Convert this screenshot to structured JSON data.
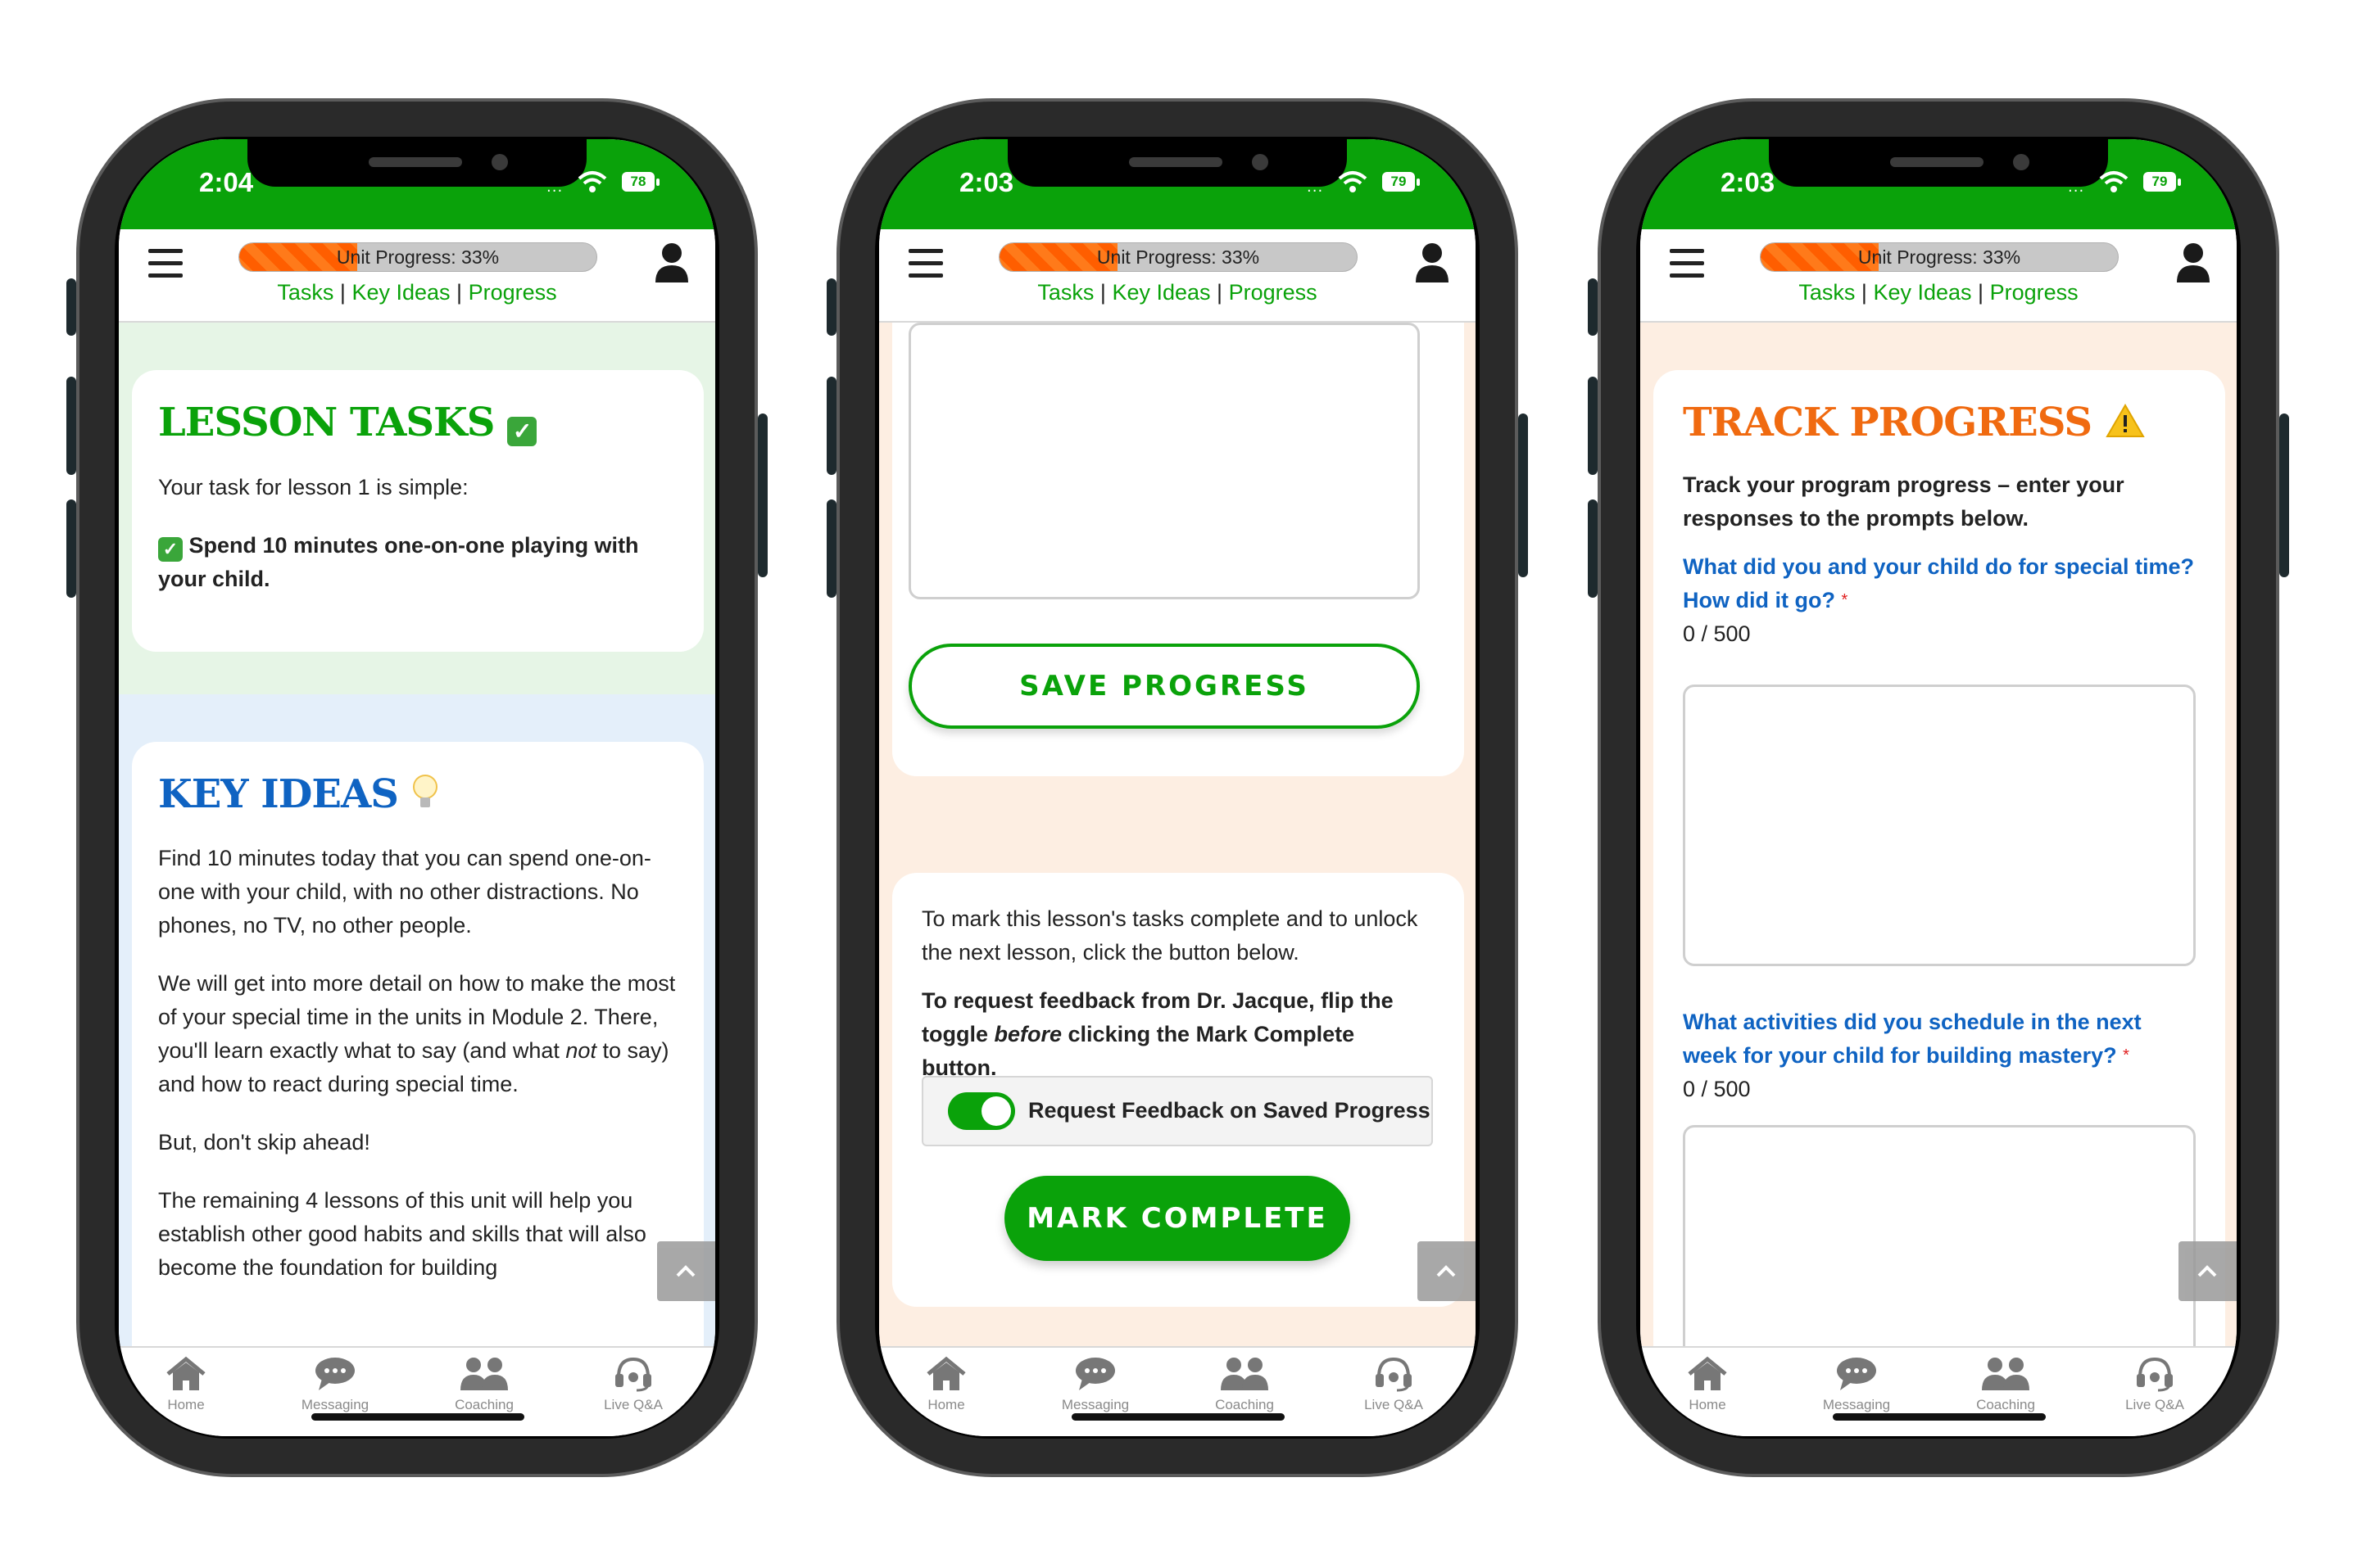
{
  "common": {
    "progress_label": "Unit Progress: 33%",
    "progress_fraction": 0.33,
    "nav": {
      "tasks": "Tasks",
      "key_ideas": "Key Ideas",
      "progress": "Progress",
      "separator": "|"
    },
    "tabs": [
      {
        "label": "Home",
        "icon": "home-icon"
      },
      {
        "label": "Messaging",
        "icon": "chat-bubble-icon"
      },
      {
        "label": "Coaching",
        "icon": "people-icon"
      },
      {
        "label": "Live Q&A",
        "icon": "headset-icon"
      }
    ],
    "signal": "..."
  },
  "phone1": {
    "time": "2:04",
    "battery": "78",
    "lesson_tasks": {
      "title": "LESSON TASKS",
      "intro": "Your task for lesson 1 is simple:",
      "task": "Spend 10 minutes one-on-one playing with your child."
    },
    "key_ideas": {
      "title": "KEY IDEAS",
      "p1": "Find 10 minutes today that you can spend one-on-one with your child, with no other distractions. No phones, no TV, no other people.",
      "p2_a": "We will get into more detail on how to make the most of your special time in the units in Module 2.  There, you'll learn exactly what to say (and what ",
      "p2_em": "not",
      "p2_b": " to say) and how to react during special time.",
      "p3": "But, don't skip ahead!",
      "p4": "The remaining 4 lessons of this unit will help you establish other good habits and skills that will also become the foundation for building"
    }
  },
  "phone2": {
    "time": "2:03",
    "battery": "79",
    "save_button": "SAVE PROGRESS",
    "mark_info": "To mark this lesson's tasks complete and to unlock the next lesson, click the button below.",
    "feedback_a": "To request feedback from Dr. Jacque, flip the toggle ",
    "feedback_em": "before",
    "feedback_b": " clicking the Mark Complete button.",
    "toggle_label": "Request Feedback on Saved Progress",
    "toggle_on": true,
    "mark_button": "MARK COMPLETE"
  },
  "phone3": {
    "time": "2:03",
    "battery": "79",
    "title": "TRACK PROGRESS",
    "intro": "Track your program progress – enter your responses to the prompts below.",
    "q1": "What did you and your child do for special time? How did it go?",
    "q1_count": "0 / 500",
    "q2": "What activities did you schedule in the next week for your child for building mastery?",
    "q2_count": "0 / 500",
    "required_mark": "*"
  },
  "colors": {
    "brand_green": "#0aa20a",
    "key_ideas_blue": "#0f63c2",
    "track_orange": "#f06a10",
    "progress_orange": "#ff6a00"
  }
}
